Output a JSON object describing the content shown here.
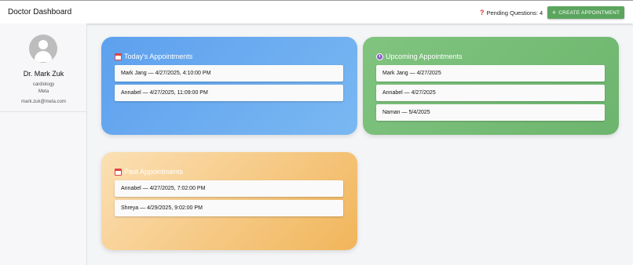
{
  "header": {
    "title": "Doctor Dashboard",
    "pending_label": "Pending Questions: 4",
    "pending_icon": "question-mark-icon",
    "create_label": "CREATE APPOINTMENT",
    "create_icon": "plus-icon",
    "accent": "#5ba55e"
  },
  "sidebar": {
    "avatar_icon": "user-avatar-icon",
    "name": "Dr. Mark Zuk",
    "specialty": "cardiology",
    "org": "Meta",
    "email": "mark.zuk@meta.com"
  },
  "cards": {
    "today": {
      "title": "Today's Appointments",
      "icon": "calendar-icon",
      "color": "#5da0ee",
      "items": [
        "Mark Jang — 4/27/2025, 4:10:00 PM",
        "Annabel — 4/27/2025, 11:09:00 PM"
      ]
    },
    "upcoming": {
      "title": "Upcoming Appointments",
      "icon": "clock-icon",
      "color": "#80c47f",
      "items": [
        "Mark Jang — 4/27/2025",
        "Annabel — 4/27/2025",
        "Naman — 5/4/2025"
      ]
    },
    "past": {
      "title": "Past Appointments",
      "icon": "calendar-icon",
      "color": "#f1b55a",
      "items": [
        "Annabel — 4/27/2025, 7:02:00 PM",
        "Shreya — 4/29/2025, 9:02:00 PM"
      ]
    }
  }
}
